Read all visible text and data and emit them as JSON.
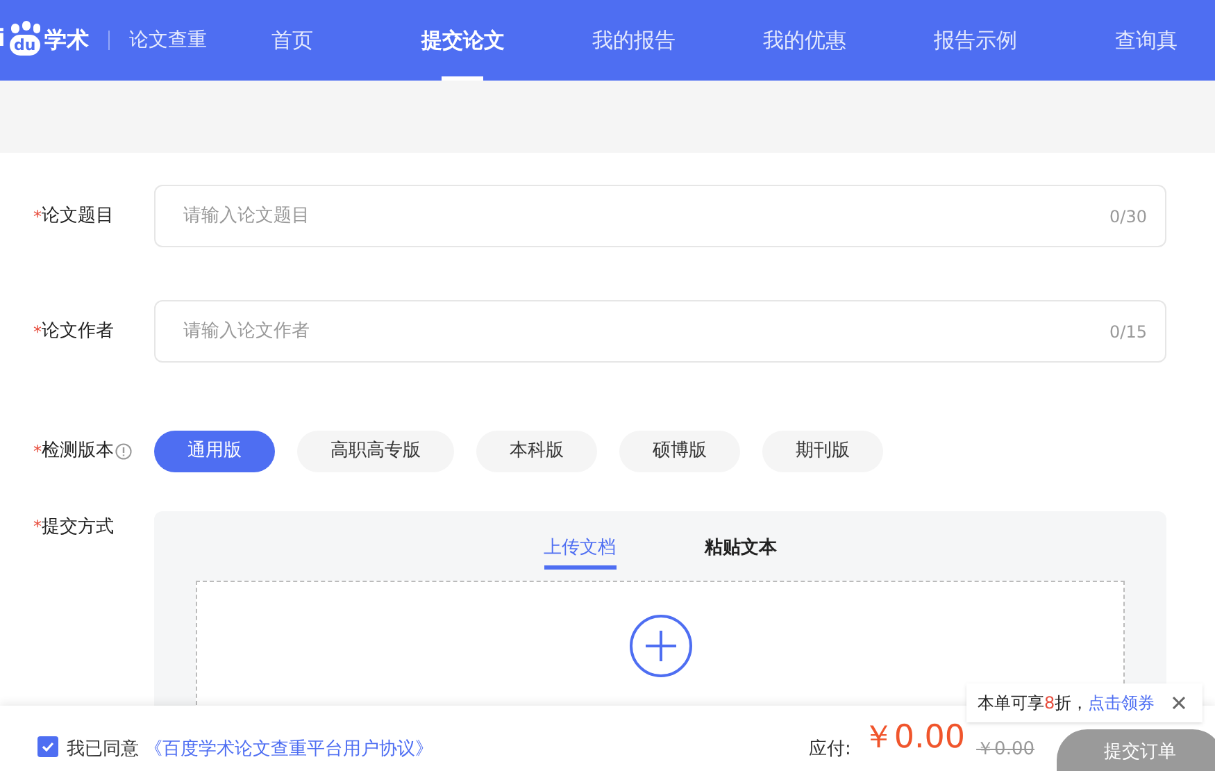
{
  "header": {
    "logo": {
      "prefix": "i",
      "mark": "du",
      "name": "学术"
    },
    "product": "论文查重",
    "nav": [
      {
        "label": "首页",
        "selected": false
      },
      {
        "label": "提交论文",
        "selected": true
      },
      {
        "label": "我的报告",
        "selected": false
      },
      {
        "label": "我的优惠",
        "selected": false
      },
      {
        "label": "报告示例",
        "selected": false
      },
      {
        "label": "查询真",
        "selected": false
      }
    ]
  },
  "form": {
    "fields": [
      {
        "mark": "*",
        "label": "论文题目",
        "placeholder": "请输入论文题目",
        "counter": "0/30"
      },
      {
        "mark": "*",
        "label": "论文作者",
        "placeholder": "请输入论文作者",
        "counter": "0/15"
      }
    ],
    "version": {
      "mark": "*",
      "label": "检测版本",
      "options": [
        {
          "label": "通用版",
          "selected": true
        },
        {
          "label": "高职高专版",
          "selected": false
        },
        {
          "label": "本科版",
          "selected": false
        },
        {
          "label": "硕博版",
          "selected": false
        },
        {
          "label": "期刊版",
          "selected": false
        }
      ]
    },
    "submit_method": {
      "mark": "*",
      "label": "提交方式",
      "tabs": [
        {
          "label": "上传文档",
          "selected": true
        },
        {
          "label": "粘贴文本",
          "selected": false
        }
      ]
    }
  },
  "coupon_tip": {
    "prefix": "本单可享",
    "discount": "8",
    "suffix": "折，",
    "link": "点击领券"
  },
  "footer": {
    "agree_checked": true,
    "agree_text": "我已同意",
    "agreement_link": "《百度学术论文查重平台用户协议》",
    "pay_label": "应付:",
    "price": "￥0.00",
    "original_price": "￥0.00",
    "submit": "提交订单"
  }
}
